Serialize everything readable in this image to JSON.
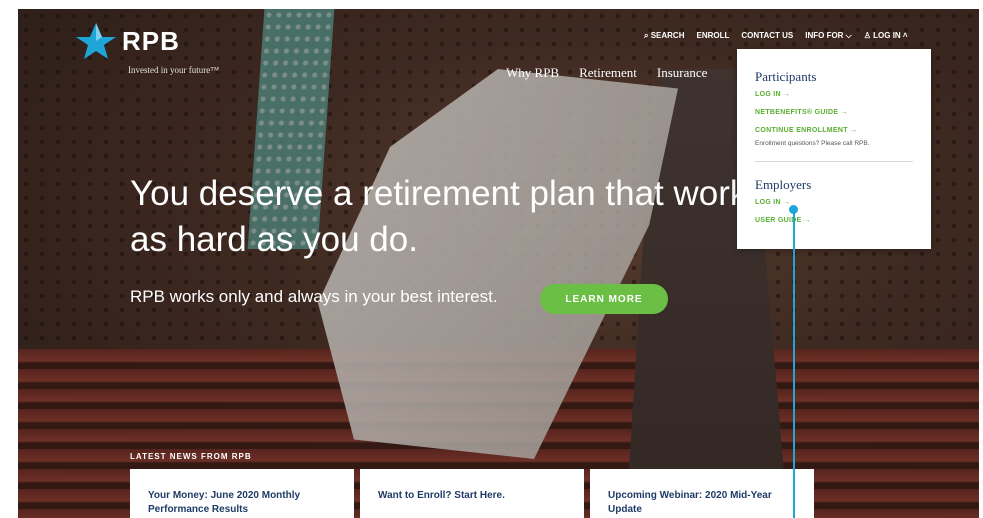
{
  "brand": {
    "name": "RPB",
    "tagline": "Invested in your future™"
  },
  "utility_nav": {
    "search": "⌕ SEARCH",
    "enroll": "ENROLL",
    "contact": "CONTACT US",
    "info_for": "INFO FOR ⌵",
    "log_in": "♙ LOG IN ˄"
  },
  "main_nav": [
    "Why RPB",
    "Retirement",
    "Insurance"
  ],
  "hero": {
    "title": "You deserve a retirement plan that works as hard as you do.",
    "subtitle": "RPB works only and always in your best interest.",
    "cta": "LEARN MORE"
  },
  "news": {
    "label": "LATEST NEWS FROM RPB",
    "cards": [
      {
        "title": "Your Money: June 2020 Monthly Performance Results"
      },
      {
        "title": "Want to Enroll? Start Here."
      },
      {
        "title": "Upcoming Webinar: 2020 Mid-Year Update"
      }
    ]
  },
  "login_dropdown": {
    "participants_heading": "Participants",
    "participant_links": [
      "LOG IN →",
      "NETBENEFITS® GUIDE →",
      "CONTINUE ENROLLMENT →"
    ],
    "participant_note": "Enrollment questions? Please call RPB.",
    "employers_heading": "Employers",
    "employer_links": [
      "LOG IN →",
      "USER GUIDE →"
    ]
  },
  "colors": {
    "accent_green": "#6bbf45",
    "navy": "#1f3b66",
    "callout_blue": "#1ea6d8"
  }
}
